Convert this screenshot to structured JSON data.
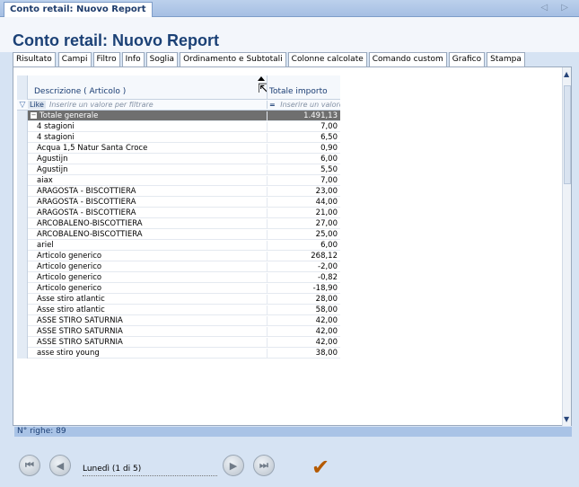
{
  "window_tab": "Conto retail: Nuovo Report",
  "window_nav": "◁ ▷",
  "title": "Conto retail: Nuovo Report",
  "tabs": [
    "Risultato",
    "Campi",
    "Filtro",
    "Info",
    "Soglia",
    "Ordinamento e Subtotali",
    "Colonne calcolate",
    "Comando custom",
    "Grafico",
    "Stampa"
  ],
  "active_tab": "Risultato",
  "grid": {
    "col_desc": "Descrizione ( Articolo )",
    "col_total": "Totale importo",
    "filter_like": "Like",
    "filter_desc_placeholder": "Inserire un valore per filtrare",
    "filter_eq": "=",
    "filter_total_placeholder": "Inserire un valore",
    "total_label": "Totale generale",
    "total_value": "1.491,13",
    "rows": [
      {
        "d": "4 stagioni",
        "v": "7,00"
      },
      {
        "d": "4 stagioni",
        "v": "6,50"
      },
      {
        "d": "Acqua 1,5 Natur Santa Croce",
        "v": "0,90"
      },
      {
        "d": "Agustijn",
        "v": "6,00"
      },
      {
        "d": "Agustijn",
        "v": "5,50"
      },
      {
        "d": "aiax",
        "v": "7,00"
      },
      {
        "d": "ARAGOSTA - BISCOTTIERA",
        "v": "23,00"
      },
      {
        "d": "ARAGOSTA - BISCOTTIERA",
        "v": "44,00"
      },
      {
        "d": "ARAGOSTA - BISCOTTIERA",
        "v": "21,00"
      },
      {
        "d": "ARCOBALENO-BISCOTTIERA",
        "v": "27,00"
      },
      {
        "d": "ARCOBALENO-BISCOTTIERA",
        "v": "25,00"
      },
      {
        "d": "ariel",
        "v": "6,00"
      },
      {
        "d": "Articolo generico",
        "v": "268,12"
      },
      {
        "d": "Articolo generico",
        "v": "-2,00"
      },
      {
        "d": "Articolo generico",
        "v": "-0,82"
      },
      {
        "d": "Articolo generico",
        "v": "-18,90"
      },
      {
        "d": "Asse stiro atlantic",
        "v": "28,00"
      },
      {
        "d": "Asse stiro atlantic",
        "v": "58,00"
      },
      {
        "d": "ASSE STIRO SATURNIA",
        "v": "42,00"
      },
      {
        "d": "ASSE STIRO SATURNIA",
        "v": "42,00"
      },
      {
        "d": "ASSE STIRO SATURNIA",
        "v": "42,00"
      },
      {
        "d": "asse stiro young",
        "v": "38,00"
      }
    ]
  },
  "status": "N° righe: 89",
  "footer": {
    "day_label": "Lunedì (1 di 5)"
  },
  "colors": {
    "accent": "#1b4176",
    "total_row": "#6f6f6f",
    "status_bar": "#a9c3e6",
    "check": "#b45a00"
  }
}
